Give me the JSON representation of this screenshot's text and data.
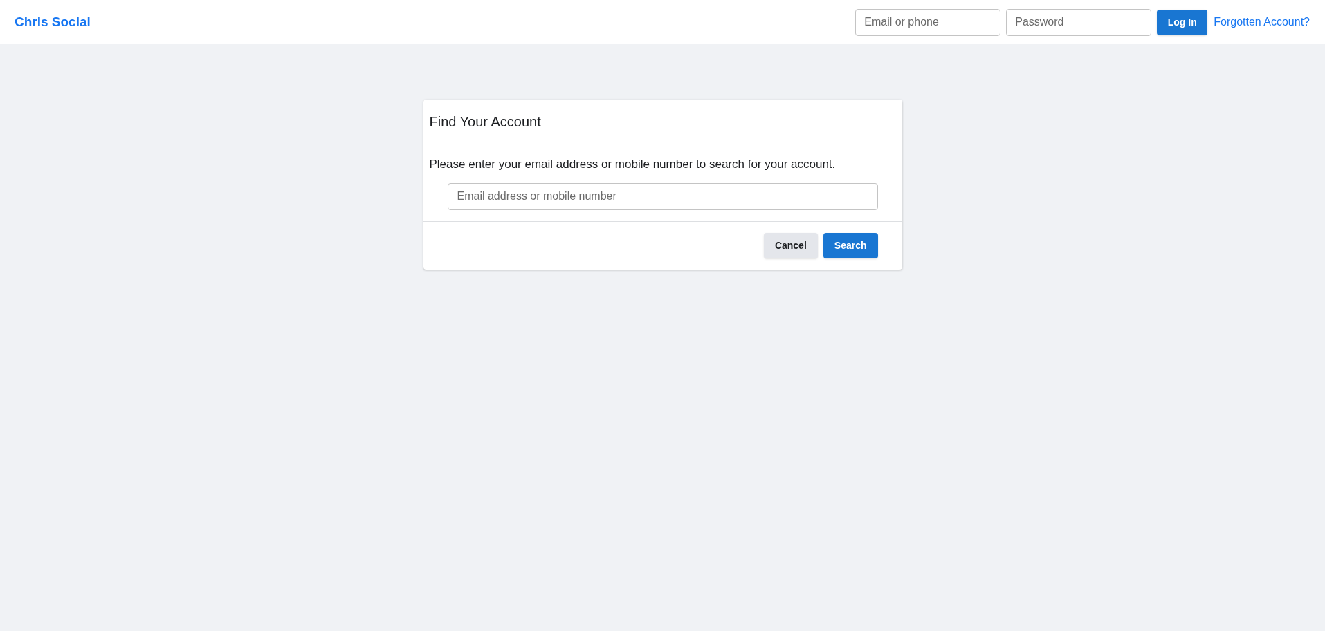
{
  "header": {
    "logo": "Chris Social",
    "email": {
      "placeholder": "Email or phone"
    },
    "password": {
      "placeholder": "Password"
    },
    "login_button": "Log In",
    "forgot_link": "Forgotten Account?"
  },
  "card": {
    "title": "Find Your Account",
    "message": "Please enter your email address or mobile number to search for your account.",
    "search_field": {
      "placeholder": "Email address or mobile number"
    },
    "buttons": [
      {
        "label": "Cancel",
        "kind": "secondary"
      },
      {
        "label": "Search",
        "kind": "primary"
      }
    ]
  }
}
